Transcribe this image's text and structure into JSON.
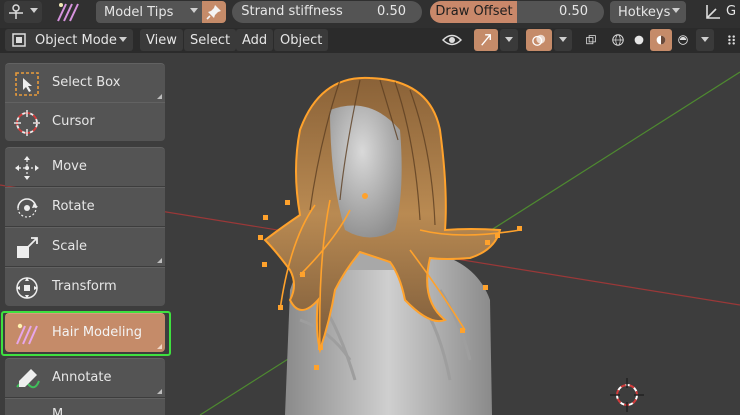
{
  "top_bar": {
    "hair_mode_label": "Model Tips",
    "strand_stiffness": {
      "label": "Strand stiffness",
      "value": "0.50",
      "fraction": 0.0
    },
    "draw_offset": {
      "label": "Draw Offset",
      "value": "0.50",
      "fraction": 0.5
    },
    "hotkeys_label": "Hotkeys",
    "global_label": "G"
  },
  "header": {
    "mode_label": "Object Mode",
    "menus": [
      "View",
      "Select",
      "Add",
      "Object"
    ]
  },
  "tools": [
    {
      "label": "Select Box",
      "icon": "select-box-icon"
    },
    {
      "label": "Cursor",
      "icon": "cursor-icon"
    },
    {
      "label": "Move",
      "icon": "move-icon"
    },
    {
      "label": "Rotate",
      "icon": "rotate-icon"
    },
    {
      "label": "Scale",
      "icon": "scale-icon"
    },
    {
      "label": "Transform",
      "icon": "transform-icon"
    },
    {
      "label": "Hair Modeling",
      "icon": "hair-modeling-icon",
      "active": true
    },
    {
      "label": "Annotate",
      "icon": "annotate-icon"
    },
    {
      "label": "M",
      "icon": "measure-icon"
    }
  ],
  "colors": {
    "accent": "#c58b69",
    "highlight_box": "#3fe03f",
    "selection_outline": "#ffa22c",
    "axis_x": "#b53a3a",
    "axis_y": "#4a8a2a"
  }
}
